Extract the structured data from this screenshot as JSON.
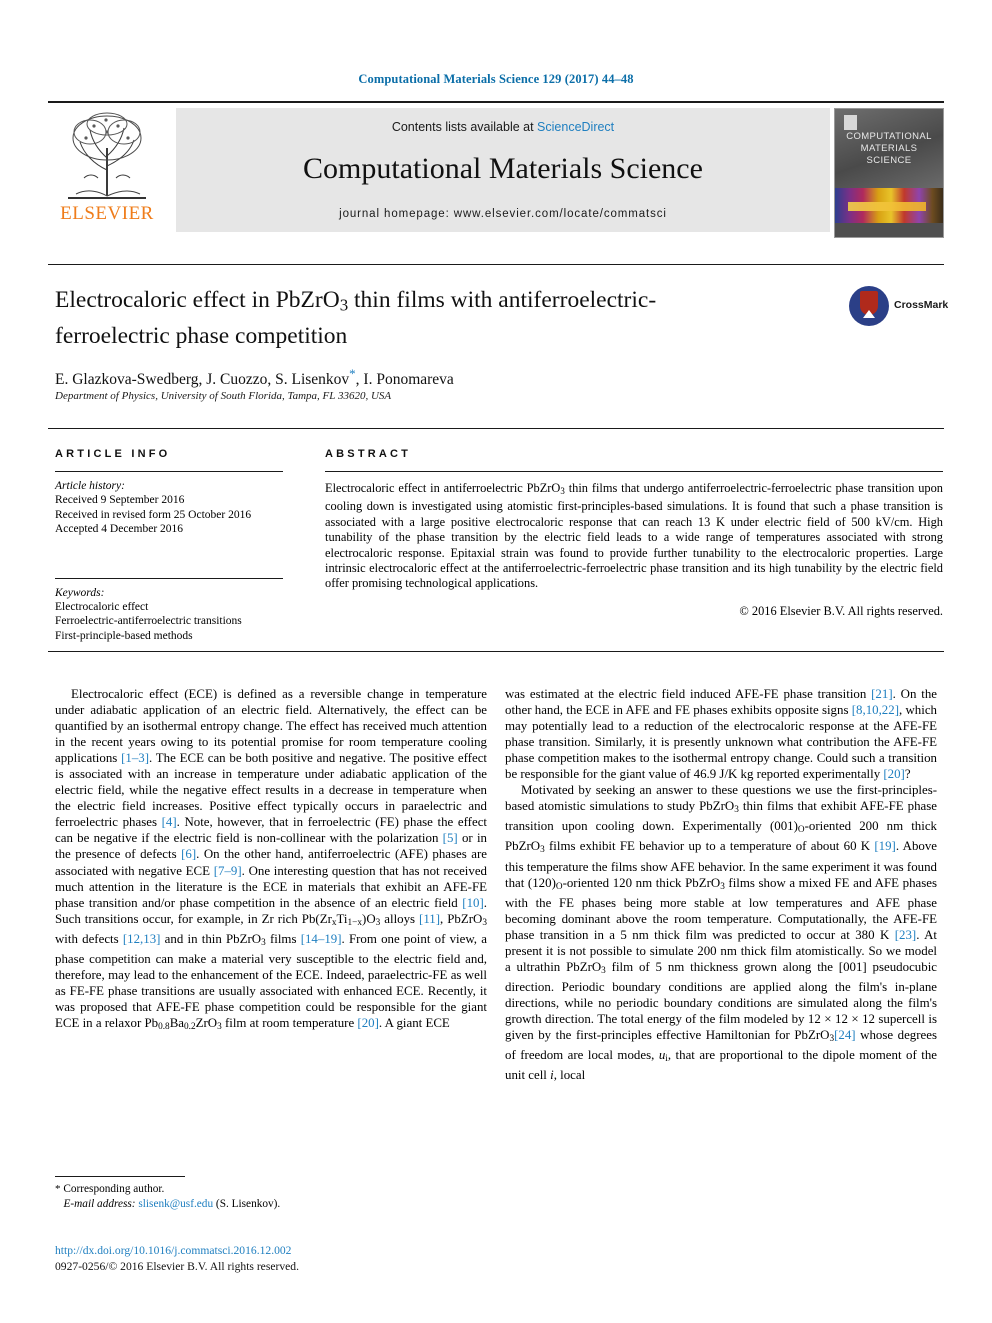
{
  "running_head": "Computational Materials Science 129 (2017) 44–48",
  "masthead": {
    "contents_prefix": "Contents lists available at ",
    "sciencedirect": "ScienceDirect",
    "journal_name": "Computational Materials Science",
    "homepage": "journal homepage: www.elsevier.com/locate/commatsci",
    "publisher": "ELSEVIER",
    "cover_title_line1": "COMPUTATIONAL",
    "cover_title_line2": "MATERIALS",
    "cover_title_line3": "SCIENCE"
  },
  "article": {
    "title_line1": "Electrocaloric effect in PbZrO",
    "title_sub1": "3",
    "title_line1b": " thin films with antiferroelectric-",
    "title_line2": "ferroelectric phase competition",
    "authors": "E. Glazkova-Swedberg, J. Cuozzo, S. Lisenkov",
    "authors_tail": ", I. Ponomareva",
    "corresponding_marker": "*",
    "affiliation": "Department of Physics, University of South Florida, Tampa, FL 33620, USA",
    "crossmark_label": "CrossMark"
  },
  "article_info": {
    "heading": "ARTICLE INFO",
    "history_label": "Article history:",
    "history": [
      "Received 9 September 2016",
      "Received in revised form 25 October 2016",
      "Accepted 4 December 2016"
    ],
    "keywords_label": "Keywords:",
    "keywords": [
      "Electrocaloric effect",
      "Ferroelectric-antiferroelectric transitions",
      "First-principle-based methods"
    ]
  },
  "abstract": {
    "heading": "ABSTRACT",
    "text_part1": "Electrocaloric effect in antiferroelectric PbZrO",
    "text_sub": "3",
    "text_part2": " thin films that undergo antiferroelectric-ferroelectric phase transition upon cooling down is investigated using atomistic first-principles-based simulations. It is found that such a phase transition is associated with a large positive electrocaloric response that can reach 13 K under electric field of 500 kV/cm. High tunability of the phase transition by the electric field leads to a wide range of temperatures associated with strong electrocaloric response. Epitaxial strain was found to provide further tunability to the electrocaloric properties. Large intrinsic electrocaloric effect at the antiferroelectric-ferroelectric phase transition and its high tunability by the electric field offer promising technological applications.",
    "copyright": "© 2016 Elsevier B.V. All rights reserved."
  },
  "body": {
    "left_paragraph_1": {
      "s1": "Electrocaloric effect (ECE) is defined as a reversible change in temperature under adiabatic application of an electric field. Alternatively, the effect can be quantified by an isothermal entropy change. The effect has received much attention in the recent years owing to its potential promise for room temperature cooling applications ",
      "r1": "[1–3]",
      "s2": ". The ECE can be both positive and negative. The positive effect is associated with an increase in temperature under adiabatic application of the electric field, while the negative effect results in a decrease in temperature when the electric field increases. Positive effect typically occurs in paraelectric and ferroelectric phases ",
      "r2": "[4]",
      "s3": ". Note, however, that in ferroelectric (FE) phase the effect can be negative if the electric field is non-collinear with the polarization ",
      "r3": "[5]",
      "s4": " or in the presence of defects ",
      "r4": "[6]",
      "s5": ". On the other hand, antiferroelectric (AFE) phases are associated with negative ECE ",
      "r5": "[7–9]",
      "s6": ". One interesting question that has not received much attention in the literature is the ECE in materials that exhibit an AFE-FE phase transition and/or phase competition in the absence of an electric field ",
      "r6": "[10]",
      "s7": ". Such transitions occur, for example, in Zr rich Pb(Zr",
      "sub_x": "x",
      "s8": "Ti",
      "sub_1x": "1−x",
      "s9": ")O",
      "sub_3a": "3",
      "s10": " alloys ",
      "r7": "[11]",
      "s11": ", PbZrO",
      "sub_3b": "3",
      "s12": " with defects ",
      "r8": "[12,13]",
      "s13": " and in thin PbZrO",
      "sub_3c": "3",
      "s14": " films ",
      "r9": "[14–19]",
      "s15": ". From one point of view, a phase competition can make a material very susceptible to the electric field and, therefore, may lead to the enhancement of the ECE. Indeed, paraelectric-FE as well as FE-FE phase transitions are usually associated with enhanced ECE. Recently, it was proposed that AFE-FE phase competition could be responsible for the giant ECE in a relaxor Pb",
      "sub_08": "0.8",
      "s16": "Ba",
      "sub_02": "0.2",
      "s17": "ZrO",
      "sub_3d": "3",
      "s18": " film at room temperature ",
      "r10": "[20]",
      "s19": ". A giant ECE"
    },
    "right_paragraph_1": {
      "s1": "was estimated at the electric field induced AFE-FE phase transition ",
      "r1": "[21]",
      "s2": ". On the other hand, the ECE in AFE and FE phases exhibits opposite signs ",
      "r2": "[8,10,22]",
      "s3": ", which may potentially lead to a reduction of the electrocaloric response at the AFE-FE phase transition. Similarly, it is presently unknown what contribution the AFE-FE phase competition makes to the isothermal entropy change. Could such a transition be responsible for the giant value of 46.9 J/K kg reported experimentally ",
      "r3": "[20]",
      "s4": "?"
    },
    "right_paragraph_2": {
      "s1": "Motivated by seeking an answer to these questions we use the first-principles-based atomistic simulations to study PbZrO",
      "sub_3a": "3",
      "s2": " thin films that exhibit AFE-FE phase transition upon cooling down. Experimentally (001)",
      "sub_o1": "O",
      "s3": "-oriented 200 nm thick PbZrO",
      "sub_3b": "3",
      "s4": " films exhibit FE behavior up to a temperature of about 60 K ",
      "r1": "[19]",
      "s5": ". Above this temperature the films show AFE behavior. In the same experiment it was found that (120)",
      "sub_o2": "O",
      "s6": "-oriented 120 nm thick PbZrO",
      "sub_3c": "3",
      "s7": " films show a mixed FE and AFE phases with the FE phases being more stable at low temperatures and AFE phase becoming dominant above the room temperature. Computationally, the AFE-FE phase transition in a 5 nm thick film was predicted to occur at 380 K ",
      "r2": "[23]",
      "s8": ". At present it is not possible to simulate 200 nm thick film atomistically. So we model a ultrathin PbZrO",
      "sub_3d": "3",
      "s9": " film of 5 nm thickness grown along the [001] pseudocubic direction. Periodic boundary conditions are applied along the film's in-plane directions, while no periodic boundary conditions are simulated along the film's growth direction. The total energy of the film modeled by 12 × 12 × 12 supercell is given by the first-principles effective Hamiltonian for PbZrO",
      "sub_3e": "3",
      "r3": "[24]",
      "s10": " whose degrees of freedom are local modes, ",
      "italic_u": "u",
      "sub_i": "i",
      "s11": ", that are proportional to the dipole moment of the unit cell ",
      "italic_i": "i",
      "s12": ", local"
    }
  },
  "footnote": {
    "star": "*",
    "corresponding": " Corresponding author.",
    "email_label": "E-mail address:",
    "email": "slisenk@usf.edu",
    "email_owner": " (S. Lisenkov)."
  },
  "footer": {
    "doi": "http://dx.doi.org/10.1016/j.commatsci.2016.12.002",
    "issn_line": "0927-0256/© 2016 Elsevier B.V. All rights reserved."
  },
  "colors": {
    "link_blue": "#1f7fc0",
    "header_blue": "#0b6ea8",
    "elsevier_orange": "#ef7c1a"
  }
}
